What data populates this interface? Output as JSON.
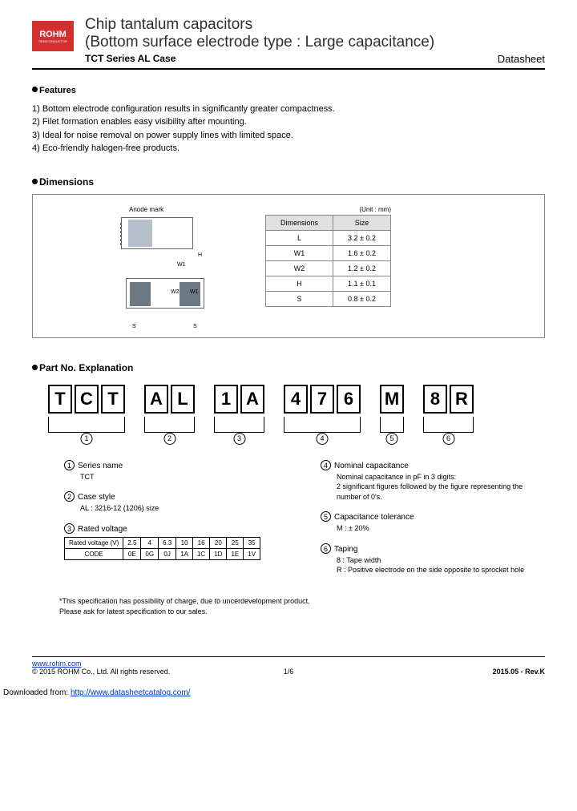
{
  "logo": {
    "name": "ROHM",
    "sub": "SEMICONDUCTOR"
  },
  "header": {
    "title1": "Chip tantalum capacitors",
    "title2": "(Bottom surface electrode type : Large capacitance)",
    "series": "TCT Series AL Case",
    "doctype": "Datasheet"
  },
  "features": {
    "heading": "Features",
    "items": [
      "1) Bottom electrode configuration results in significantly greater compactness.",
      "2) Filet formation enables easy visibility after mounting.",
      "3) Ideal for noise removal on power supply lines with limited space.",
      "4) Eco-friendly halogen-free products."
    ]
  },
  "dimensions": {
    "heading": "Dimensions",
    "anode": "Anode mark",
    "unit": "(Unit : mm)",
    "lbl_h": "H",
    "lbl_w1": "W1",
    "lbl_w2": "W2",
    "lbl_w3": "W1",
    "lbl_s": "S",
    "cols": [
      "Dimensions",
      "Size"
    ],
    "rows": [
      [
        "L",
        "3.2 ± 0.2"
      ],
      [
        "W1",
        "1.6 ± 0.2"
      ],
      [
        "W2",
        "1.2 ± 0.2"
      ],
      [
        "H",
        "1.1 ± 0.1"
      ],
      [
        "S",
        "0.8 ± 0.2"
      ]
    ]
  },
  "partno": {
    "heading": "Part No. Explanation",
    "groups": [
      [
        "T",
        "C",
        "T"
      ],
      [
        "A",
        "L"
      ],
      [
        "1",
        "A"
      ],
      [
        "4",
        "7",
        "6"
      ],
      [
        "M"
      ],
      [
        "8",
        "R"
      ]
    ],
    "expl": [
      {
        "n": "1",
        "label": "Series name",
        "body": "TCT"
      },
      {
        "n": "2",
        "label": "Case style",
        "body": "AL : 3216-12 (1206) size"
      },
      {
        "n": "3",
        "label": "Rated voltage",
        "body": ""
      },
      {
        "n": "4",
        "label": "Nominal capacitance",
        "body": "Nominal capacitance in pF in 3 digits:\n2 significant figures followed by the figure representing the number of 0's."
      },
      {
        "n": "5",
        "label": "Capacitance tolerance",
        "body": "M : ± 20%"
      },
      {
        "n": "6",
        "label": "Taping",
        "body": "8 : Tape width\nR : Positive electrode on the side opposite to sprocket hole"
      }
    ],
    "volt_table": {
      "r1": [
        "Rated voltage (V)",
        "2.5",
        "4",
        "6.3",
        "10",
        "16",
        "20",
        "25",
        "35"
      ],
      "r2": [
        "CODE",
        "0E",
        "0G",
        "0J",
        "1A",
        "1C",
        "1D",
        "1E",
        "1V"
      ]
    },
    "note": "*This specification has possibility of charge, due to uncerdevelopment product.\n Please ask for latest specification to our sales."
  },
  "footer": {
    "url": "www.rohm.com",
    "copyright": "© 2015 ROHM Co., Ltd. All rights reserved.",
    "page": "1/6",
    "rev": "2015.05 - Rev.K",
    "download_pre": "Downloaded from:",
    "download_url": "http://www.datasheetcatalog.com/"
  }
}
